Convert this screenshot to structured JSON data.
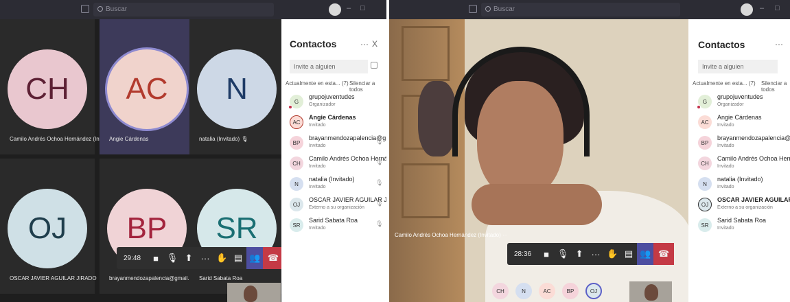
{
  "search": {
    "placeholder": "Buscar"
  },
  "contacts": {
    "title": "Contactos",
    "more": "···",
    "close": "X",
    "invite_placeholder": "Invite a alguien",
    "section": "Actualmente en esta... (7)",
    "mute_all": "Silenciar a todos"
  },
  "left": {
    "tiles": [
      {
        "initials": "CH",
        "name": "Camilo Andrés Ochoa Hernández (Invi...",
        "bg": "#e9c7cf",
        "fg": "#5d2034"
      },
      {
        "initials": "AC",
        "name": "Angie Cárdenas",
        "bg": "#f0d3cc",
        "fg": "#b23a2d"
      },
      {
        "initials": "N",
        "name": "natalia (Invitado)",
        "bg": "#cdd8e6",
        "fg": "#1e3b66"
      },
      {
        "initials": "OJ",
        "name": "OSCAR JAVIER AGUILAR JIRADO",
        "bg": "#cfe0e6",
        "fg": "#1f3e4c"
      },
      {
        "initials": "BP",
        "name": "brayanmendozapalencia@gmail.co...",
        "bg": "#f0d3d6",
        "fg": "#a3243d"
      },
      {
        "initials": "SR",
        "name": "Sarid Sabata Roa",
        "bg": "#d6e8ea",
        "fg": "#1b6f73"
      }
    ],
    "timer": "29:48",
    "participants": [
      {
        "initials": "G",
        "name": "grupojuventudes",
        "role": "Organizador",
        "bg": "#e2efd8",
        "bold": false
      },
      {
        "initials": "AC",
        "name": "Angie Cárdenas",
        "role": "Invitado",
        "bg": "#fbdcd6",
        "bold": true
      },
      {
        "initials": "BP",
        "name": "brayanmendozapalencia@g...",
        "role": "Invitado",
        "bg": "#f5d3da",
        "bold": false
      },
      {
        "initials": "CH",
        "name": "Camilo Andrés Ochoa Herná...",
        "role": "Invitado",
        "bg": "#f3d6de",
        "bold": false
      },
      {
        "initials": "N",
        "name": "natalia (Invitado)",
        "role": "Invitado",
        "bg": "#d5dff0",
        "bold": false
      },
      {
        "initials": "OJ",
        "name": "OSCAR JAVIER AGUILAR JIR...",
        "role": "Externo a su organización",
        "bg": "#dbe7ec",
        "bold": false
      },
      {
        "initials": "SR",
        "name": "Sarid Sabata Roa",
        "role": "Invitado",
        "bg": "#d9ecec",
        "bold": false
      }
    ]
  },
  "right": {
    "video_caption": "Camilo Andrés Ochoa Hernández (Invitado) ···",
    "timer": "28:36",
    "participants": [
      {
        "initials": "G",
        "name": "grupojuventudes",
        "role": "Organizador",
        "bg": "#e2efd8",
        "bold": false
      },
      {
        "initials": "AC",
        "name": "Angie Cárdenas",
        "role": "Invitado",
        "bg": "#fbdcd6",
        "bold": false
      },
      {
        "initials": "BP",
        "name": "brayanmendozapalencia@g...",
        "role": "Invitado",
        "bg": "#f5d3da",
        "bold": false
      },
      {
        "initials": "CH",
        "name": "Camilo Andrés Ochoa Hernández...",
        "role": "Invitado",
        "bg": "#f3d6de",
        "bold": false
      },
      {
        "initials": "N",
        "name": "natalia (Invitado)",
        "role": "Invitado",
        "bg": "#d5dff0",
        "bold": false
      },
      {
        "initials": "OJ",
        "name": "OSCAR JAVIER AGUILAR JI...",
        "role": "Externo a su organización",
        "bg": "#dbe7ec",
        "bold": true
      },
      {
        "initials": "SR",
        "name": "Sarid Sabata Roa",
        "role": "Invitado",
        "bg": "#d9ecec",
        "bold": false
      }
    ],
    "bottom_avatars": [
      {
        "initials": "CH",
        "bg": "#f3d6de"
      },
      {
        "initials": "N",
        "bg": "#d5dff0"
      },
      {
        "initials": "AC",
        "bg": "#fbdcd6"
      },
      {
        "initials": "BP",
        "bg": "#f5d3da"
      },
      {
        "initials": "OJ",
        "bg": "#dbe7ec"
      }
    ]
  },
  "colors": {
    "people_active": "#4d4ea0",
    "hangup": "#c43a45",
    "titlebar": "#2c2c34"
  }
}
